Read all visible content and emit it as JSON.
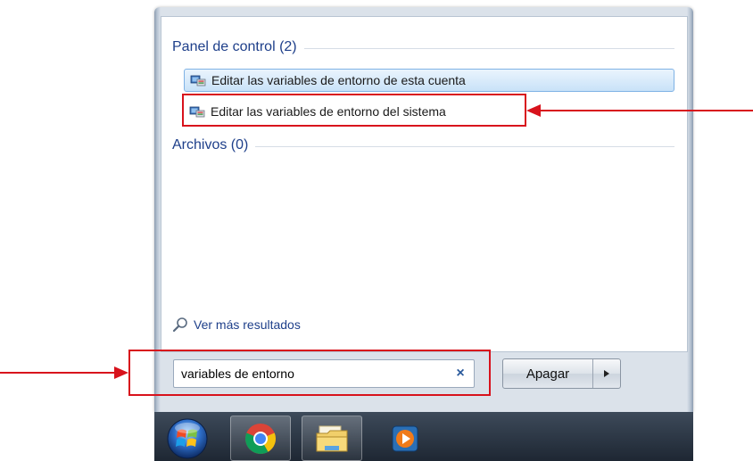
{
  "start_menu": {
    "groups": [
      {
        "header": "Panel de control (2)"
      },
      {
        "header": "Archivos (0)"
      }
    ],
    "results": [
      {
        "label": "Editar las variables de entorno de esta cuenta",
        "highlighted": true
      },
      {
        "label": "Editar las variables de entorno del sistema",
        "highlighted": false
      }
    ],
    "see_more_label": "Ver más resultados",
    "search": {
      "value": "variables de entorno"
    },
    "clear_symbol": "×",
    "shutdown_label": "Apagar"
  },
  "taskbar": {
    "items": [
      "start-orb",
      "chrome",
      "file-explorer",
      "media-player"
    ]
  },
  "annotation_color": "#d8121c"
}
